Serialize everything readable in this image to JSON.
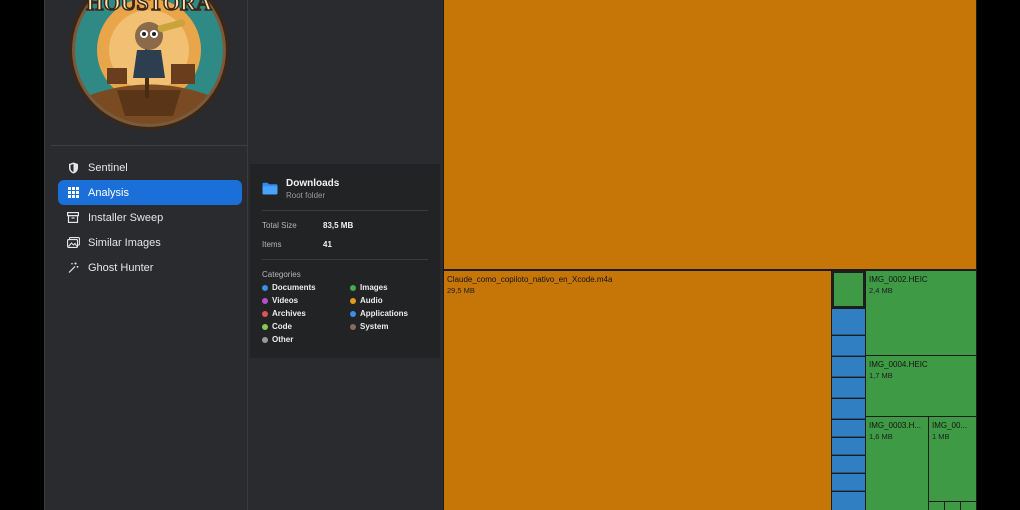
{
  "sidebar": {
    "logo_text": "HOUSTORA",
    "items": [
      {
        "label": "Sentinel",
        "icon": "shield-icon"
      },
      {
        "label": "Analysis",
        "icon": "grid-icon"
      },
      {
        "label": "Installer Sweep",
        "icon": "archive-box-icon"
      },
      {
        "label": "Similar Images",
        "icon": "photos-icon"
      },
      {
        "label": "Ghost Hunter",
        "icon": "magic-wand-icon"
      }
    ],
    "active_item": "Analysis"
  },
  "info": {
    "folder_name": "Downloads",
    "folder_sub": "Root folder",
    "total_size_label": "Total Size",
    "total_size_value": "83,5 MB",
    "items_label": "Items",
    "items_value": "41",
    "categories_title": "Categories",
    "categories": [
      {
        "label": "Documents",
        "color": "#3b8ee6"
      },
      {
        "label": "Images",
        "color": "#3fae4e"
      },
      {
        "label": "Videos",
        "color": "#b44fd0"
      },
      {
        "label": "Audio",
        "color": "#e69a1c"
      },
      {
        "label": "Archives",
        "color": "#e05353"
      },
      {
        "label": "Applications",
        "color": "#3a8ee8"
      },
      {
        "label": "Code",
        "color": "#8cc84b"
      },
      {
        "label": "System",
        "color": "#8a6a5a"
      },
      {
        "label": "Other",
        "color": "#9a9a9a"
      }
    ]
  },
  "treemap": {
    "tiles": [
      {
        "name": "",
        "size": "",
        "color": "#c67607"
      },
      {
        "name": "Claude_como_copiloto_nativo_en_Xcode.m4a",
        "size": "29,5 MB",
        "color": "#c67607"
      },
      {
        "name": "IMG_0002.HEIC",
        "size": "2,4 MB",
        "color": "#3f9a45"
      },
      {
        "name": "IMG_0004.HEIC",
        "size": "1,7 MB",
        "color": "#3f9a45"
      },
      {
        "name": "IMG_0003.H...",
        "size": "1,6 MB",
        "color": "#3f9a45"
      },
      {
        "name": "IMG_00...",
        "size": "1 MB",
        "color": "#3f9a45"
      }
    ],
    "small_tile_color_blue": "#2f7fc2",
    "small_tile_color_green": "#3f9a45"
  }
}
